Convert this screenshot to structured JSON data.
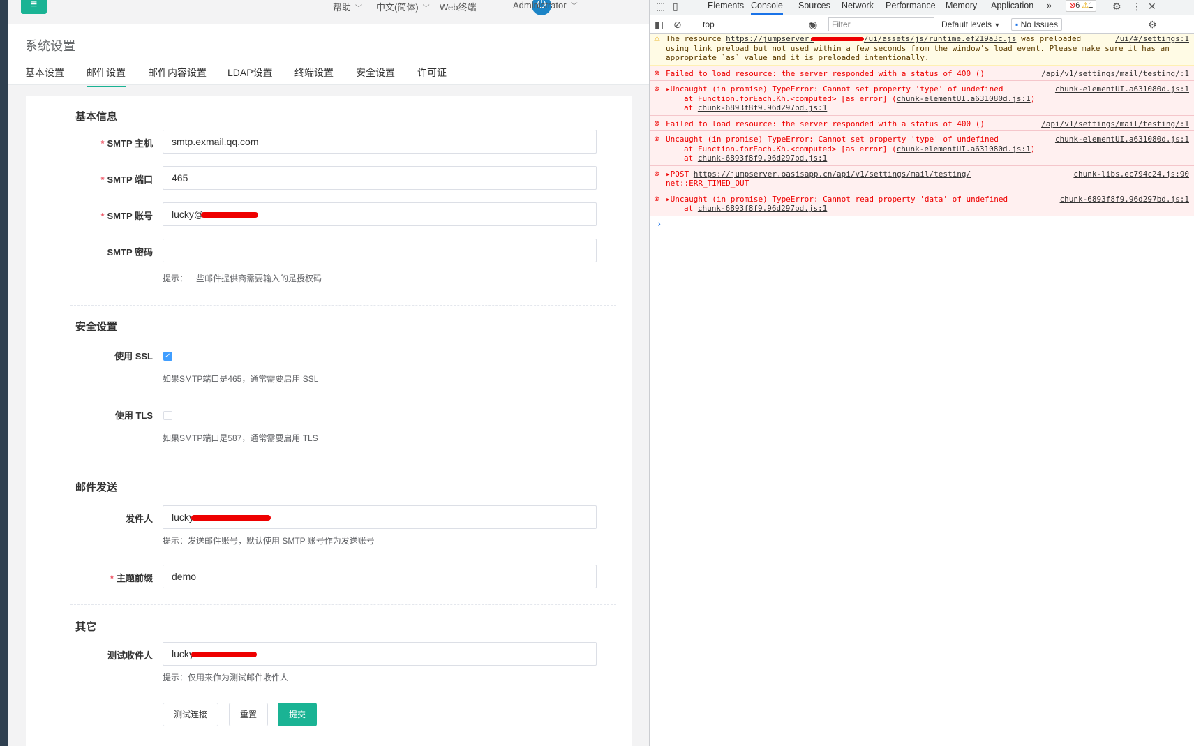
{
  "topnav": {
    "help": "帮助",
    "language": "中文(简体)",
    "web_terminal": "Web终端",
    "user": "Administrator"
  },
  "page": {
    "title": "系统设置",
    "tabs": [
      "基本设置",
      "邮件设置",
      "邮件内容设置",
      "LDAP设置",
      "终端设置",
      "安全设置",
      "许可证"
    ],
    "active_tab": "邮件设置"
  },
  "form": {
    "basic_title": "基本信息",
    "smtp_host_label": "SMTP 主机",
    "smtp_host_value": "smtp.exmail.qq.com",
    "smtp_port_label": "SMTP 端口",
    "smtp_port_value": "465",
    "smtp_account_label": "SMTP 账号",
    "smtp_account_value": "lucky@",
    "smtp_password_label": "SMTP 密码",
    "smtp_password_value": "",
    "password_hint": "提示：一些邮件提供商需要输入的是授权码",
    "security_title": "安全设置",
    "use_ssl_label": "使用 SSL",
    "use_ssl_checked": true,
    "ssl_hint": "如果SMTP端口是465，通常需要启用 SSL",
    "use_tls_label": "使用 TLS",
    "use_tls_checked": false,
    "tls_hint": "如果SMTP端口是587，通常需要启用 TLS",
    "send_title": "邮件发送",
    "sender_label": "发件人",
    "sender_value": "lucky",
    "sender_hint": "提示：发送邮件账号，默认使用 SMTP 账号作为发送账号",
    "subject_prefix_label": "主题前缀",
    "subject_prefix_value": "demo",
    "other_title": "其它",
    "test_recipient_label": "测试收件人",
    "test_recipient_value": "lucky",
    "test_recipient_hint": "提示：仅用来作为测试邮件收件人",
    "btn_test": "测试连接",
    "btn_reset": "重置",
    "btn_submit": "提交"
  },
  "devtools": {
    "tabs": [
      "Elements",
      "Console",
      "Sources",
      "Network",
      "Performance",
      "Memory",
      "Application"
    ],
    "active_tab": "Console",
    "more": "»",
    "error_count": "6",
    "warning_count": "1",
    "context": "top",
    "filter_placeholder": "Filter",
    "levels": "Default levels",
    "no_issues": "No Issues",
    "messages": [
      {
        "type": "warn",
        "text_a": "The resource ",
        "link": "https://jumpserver.",
        "link_b": "/ui/assets/js/runtime.ef219a3c.js",
        "text_b": " was preloaded using link preload but not used within a few seconds from the window's load event. Please make sure it has an appropriate `as` value and it is preloaded intentionally.",
        "source": "/ui/#/settings:1"
      },
      {
        "type": "err",
        "text": "Failed to load resource: the server responded with a status of 400 ()",
        "source": "/api/v1/settings/mail/testing/:1"
      },
      {
        "type": "err",
        "text": "▸Uncaught (in promise) TypeError: Cannot set property 'type' of undefined",
        "line2": "at Function.forEach.Kh.<computed> [as error] (",
        "line2_link": "chunk-elementUI.a631080d.js:1",
        "line2_end": ")",
        "line3": "at ",
        "line3_link": "chunk-6893f8f9.96d297bd.js:1",
        "source": "chunk-elementUI.a631080d.js:1"
      },
      {
        "type": "err",
        "text": "Failed to load resource: the server responded with a status of 400 ()",
        "source": "/api/v1/settings/mail/testing/:1"
      },
      {
        "type": "err",
        "text": "Uncaught (in promise) TypeError: Cannot set property 'type' of undefined",
        "line2": "at Function.forEach.Kh.<computed> [as error] (",
        "line2_link": "chunk-elementUI.a631080d.js:1",
        "line2_end": ")",
        "line3": "at ",
        "line3_link": "chunk-6893f8f9.96d297bd.js:1",
        "source": "chunk-elementUI.a631080d.js:1"
      },
      {
        "type": "err",
        "text": "▸POST ",
        "link": "https://jumpserver.oasisapp.cn/api/v1/settings/mail/testing/",
        "line2": "net::ERR_TIMED_OUT",
        "source": "chunk-libs.ec794c24.js:90"
      },
      {
        "type": "err",
        "text": "▸Uncaught (in promise) TypeError: Cannot read property 'data' of undefined",
        "line3": "at ",
        "line3_link": "chunk-6893f8f9.96d297bd.js:1",
        "source": "chunk-6893f8f9.96d297bd.js:1"
      }
    ],
    "prompt": "›"
  }
}
